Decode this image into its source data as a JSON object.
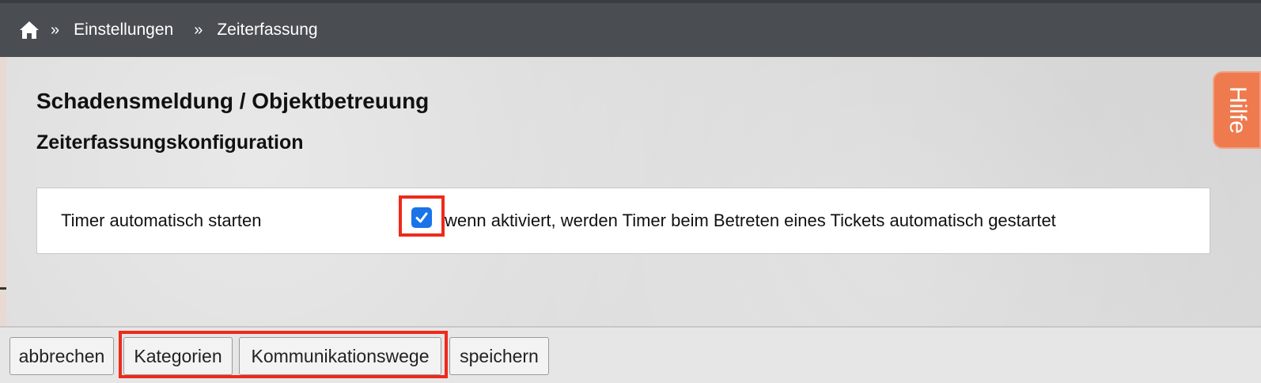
{
  "breadcrumb": {
    "home_icon": "home-icon",
    "separator": "»",
    "items": [
      "Einstellungen",
      "Zeiterfassung"
    ]
  },
  "page": {
    "title": "Schadensmeldung / Objektbetreuung",
    "section_title": "Zeiterfassungskonfiguration"
  },
  "settings": {
    "timer_label": "Timer automatisch starten",
    "timer_checked": true,
    "timer_description": "wenn aktiviert, werden Timer beim Betreten eines Tickets automatisch gestartet"
  },
  "help": {
    "label": "Hilfe"
  },
  "footer": {
    "cancel_label": "abbrechen",
    "categories_label": "Kategorien",
    "channels_label": "Kommunikationswege",
    "save_label": "speichern"
  },
  "colors": {
    "topbar": "#4a4d52",
    "accent_checkbox": "#1a73e8",
    "help_tab": "#ee7a4e",
    "highlight": "#ee2a1b"
  }
}
